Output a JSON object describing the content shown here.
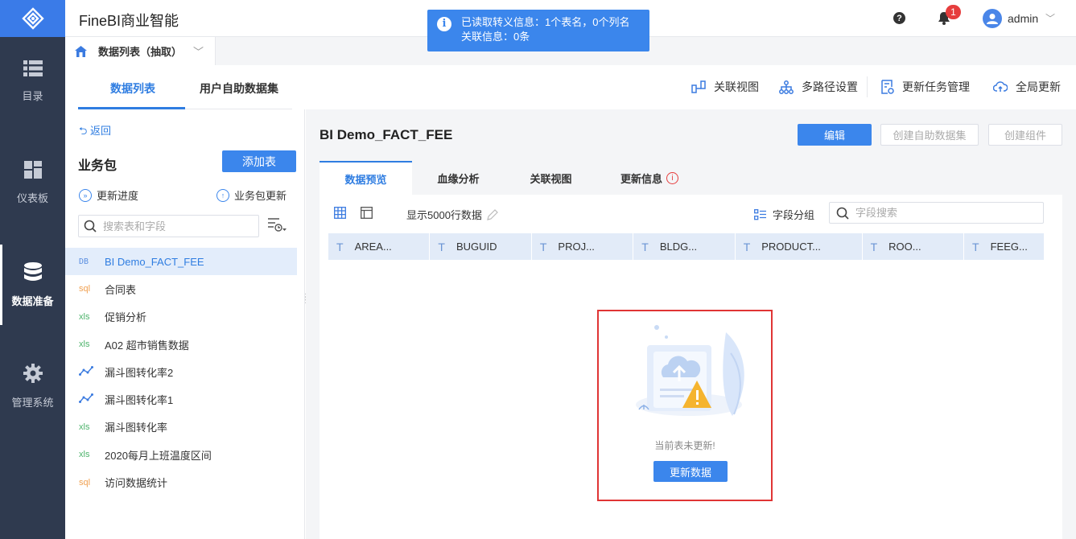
{
  "app": {
    "title": "FineBI商业智能",
    "user": "admin",
    "notification_count": "1"
  },
  "toast": {
    "line1": "已读取转义信息：1个表名，0个列名",
    "line2": "关联信息：0条"
  },
  "nav": [
    {
      "label": "目录"
    },
    {
      "label": "仪表板"
    },
    {
      "label": "数据准备"
    },
    {
      "label": "管理系统"
    }
  ],
  "crumb": {
    "label": "数据列表（抽取）"
  },
  "left_tabs": {
    "data_list": "数据列表",
    "self_service": "用户自助数据集"
  },
  "toolbar": {
    "relation_view": "关联视图",
    "multi_path": "多路径设置",
    "update_task": "更新任务管理",
    "global_update": "全局更新"
  },
  "sidebar": {
    "back": "返回",
    "package_title": "业务包",
    "add_table": "添加表",
    "update_progress": "更新进度",
    "package_update": "业务包更新",
    "search_placeholder": "搜索表和字段",
    "tables": [
      {
        "type": "DB",
        "name": "BI Demo_FACT_FEE"
      },
      {
        "type": "sql",
        "name": "合同表"
      },
      {
        "type": "xls",
        "name": "促销分析"
      },
      {
        "type": "xls",
        "name": "A02 超市销售数据"
      },
      {
        "type": "chart",
        "name": "漏斗图转化率2"
      },
      {
        "type": "chart",
        "name": "漏斗图转化率1"
      },
      {
        "type": "xls",
        "name": "漏斗图转化率"
      },
      {
        "type": "xls",
        "name": "2020每月上班温度区间"
      },
      {
        "type": "sql",
        "name": "访问数据统计"
      }
    ]
  },
  "content": {
    "title": "BI Demo_FACT_FEE",
    "edit": "编辑",
    "create_self_dataset": "创建自助数据集",
    "create_component": "创建组件",
    "tabs": {
      "preview": "数据预览",
      "lineage": "血缘分析",
      "relation": "关联视图",
      "update_info": "更新信息"
    },
    "show_rows": "显示5000行数据",
    "field_group": "字段分组",
    "field_search_placeholder": "字段搜索",
    "columns": [
      "AREA...",
      "BUGUID",
      "PROJ...",
      "BLDG...",
      "PRODUCT...",
      "ROO...",
      "FEEG..."
    ],
    "empty_message": "当前表未更新!",
    "refresh_button": "更新数据"
  },
  "colors": {
    "accent": "#3b86ec",
    "nav_bg": "#2f3a4f",
    "alert": "#e03535"
  }
}
